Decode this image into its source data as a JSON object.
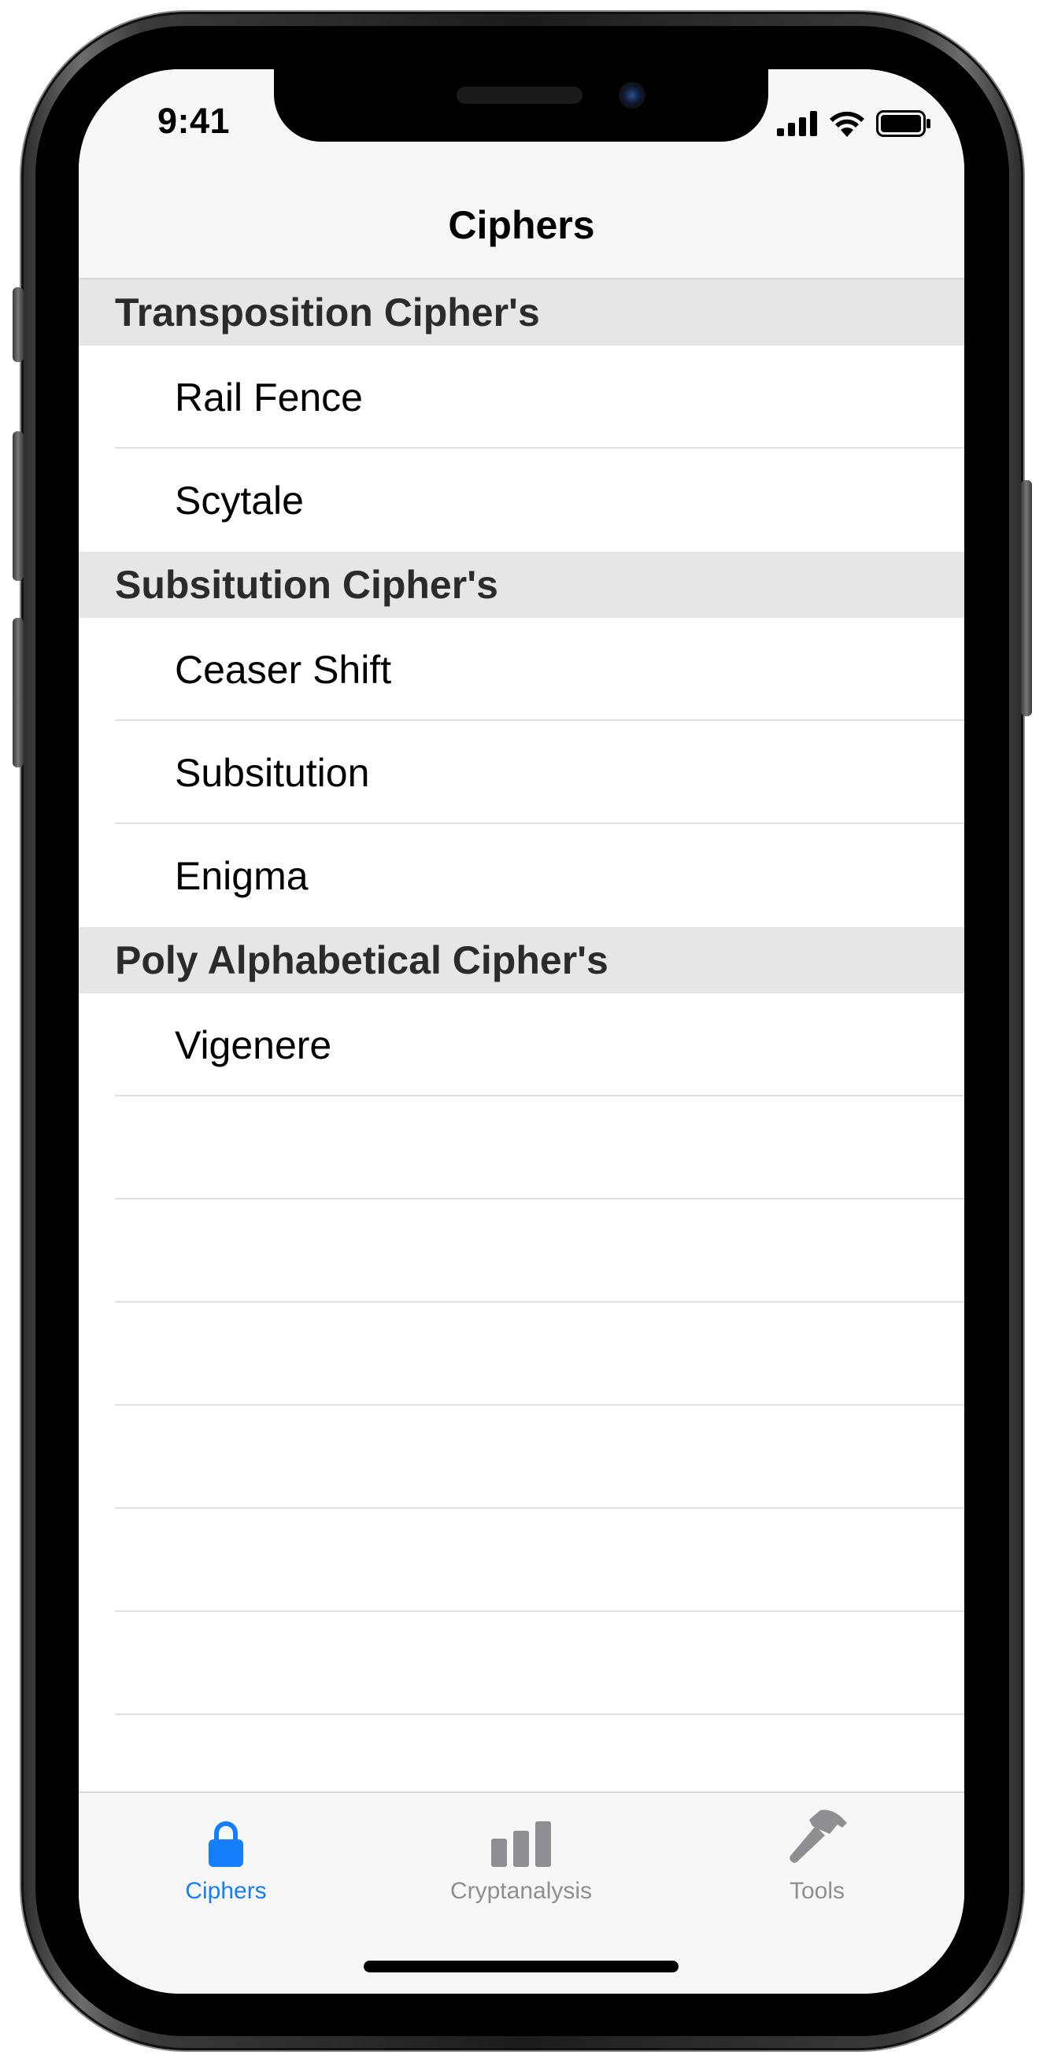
{
  "status_bar": {
    "time": "9:41",
    "icons": [
      "cellular-signal-icon",
      "wifi-icon",
      "battery-icon"
    ]
  },
  "nav": {
    "title": "Ciphers"
  },
  "sections": [
    {
      "header": "Transposition Cipher's",
      "items": [
        "Rail Fence",
        "Scytale"
      ]
    },
    {
      "header": "Subsitution Cipher's",
      "items": [
        "Ceaser Shift",
        "Subsitution",
        "Enigma"
      ]
    },
    {
      "header": "Poly Alphabetical Cipher's",
      "items": [
        "Vigenere"
      ]
    }
  ],
  "tab_bar": {
    "tabs": [
      {
        "label": "Ciphers",
        "icon": "lock-icon",
        "selected": true
      },
      {
        "label": "Cryptanalysis",
        "icon": "bar-chart-icon",
        "selected": false
      },
      {
        "label": "Tools",
        "icon": "hammer-icon",
        "selected": false
      }
    ]
  },
  "colors": {
    "accent": "#147efb",
    "inactive": "#8e8e93",
    "section_header_bg": "#e6e6e7",
    "bar_bg": "#f7f7f7"
  }
}
